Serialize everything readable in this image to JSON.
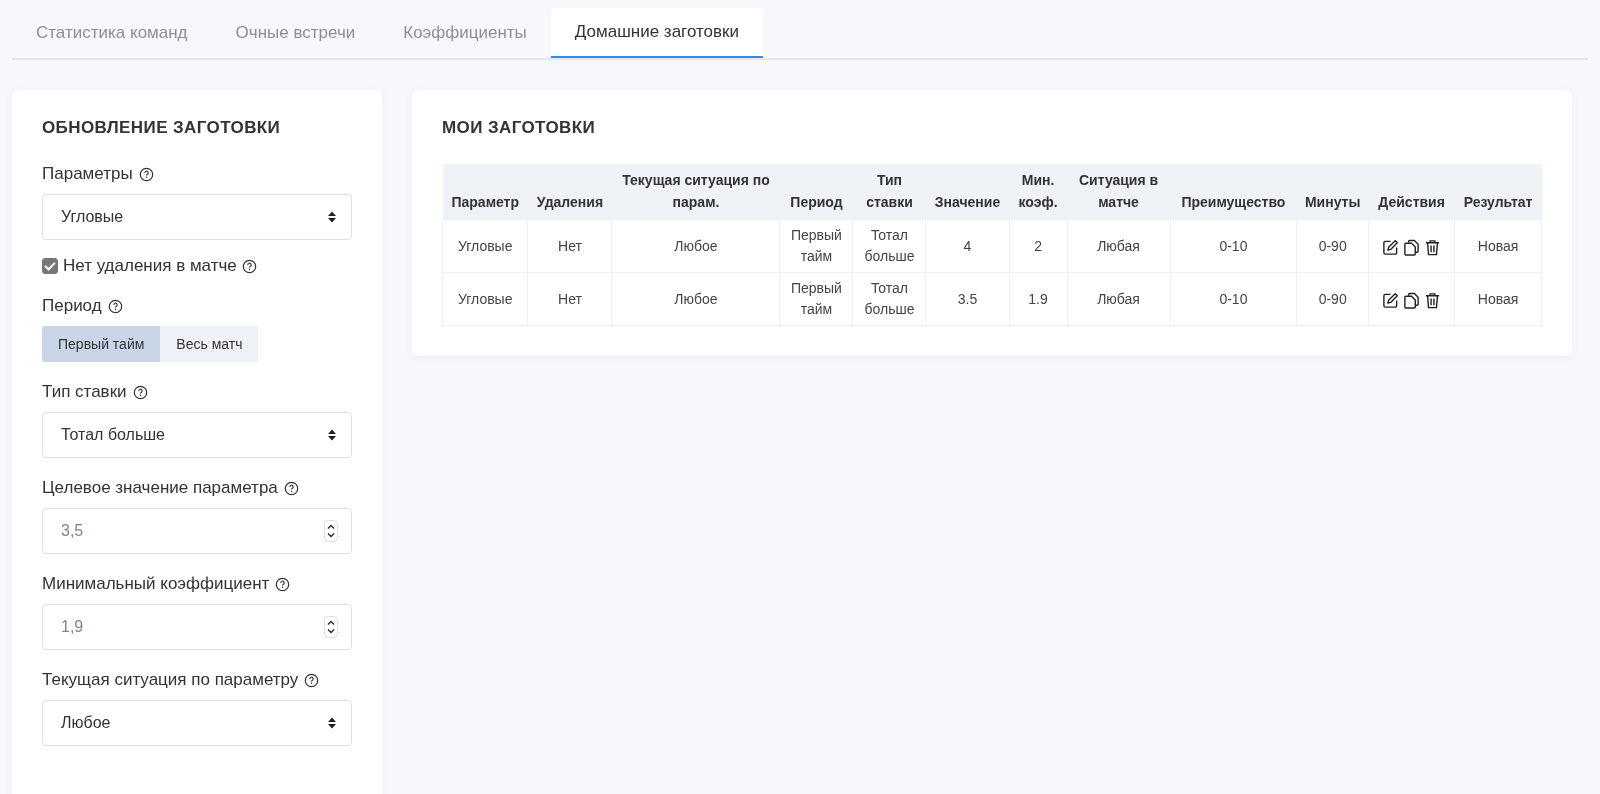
{
  "tabs": [
    {
      "label": "Статистика команд",
      "selected": false
    },
    {
      "label": "Очные встречи",
      "selected": false
    },
    {
      "label": "Коэффициенты",
      "selected": false
    },
    {
      "label": "Домашние заготовки",
      "selected": true
    }
  ],
  "form": {
    "title": "ОБНОВЛЕНИЕ ЗАГОТОВКИ",
    "fields": [
      {
        "kind": "select",
        "label": "Параметры",
        "value": "Угловые"
      },
      {
        "kind": "checkbox",
        "label": "Нет удаления в матче",
        "checked": true
      },
      {
        "kind": "segmented",
        "label": "Период",
        "options": [
          {
            "label": "Первый тайм",
            "selected": true
          },
          {
            "label": "Весь матч",
            "selected": false
          }
        ]
      },
      {
        "kind": "select",
        "label": "Тип ставки",
        "value": "Тотал больше"
      },
      {
        "kind": "number",
        "label": "Целевое значение параметра",
        "placeholder": "3,5"
      },
      {
        "kind": "number",
        "label": "Минимальный коэффициент",
        "placeholder": "1,9"
      },
      {
        "kind": "select",
        "label": "Текущая ситуация по параметру",
        "value": "Любое"
      }
    ]
  },
  "table": {
    "title": "МОИ ЗАГОТОВКИ",
    "columns": [
      "Параметр",
      "Удаления",
      "Текущая ситуация по парам.",
      "Период",
      "Тип ставки",
      "Значение",
      "Мин. коэф.",
      "Ситуация в матче",
      "Преимущество",
      "Минуты",
      "Действия",
      "Результат"
    ],
    "rows": [
      {
        "cells": [
          "Угловые",
          "Нет",
          "Любое",
          "Первый тайм",
          "Тотал больше",
          "4",
          "2",
          "Любая",
          "0-10",
          "0-90"
        ],
        "result": "Новая"
      },
      {
        "cells": [
          "Угловые",
          "Нет",
          "Любое",
          "Первый тайм",
          "Тотал больше",
          "3.5",
          "1.9",
          "Любая",
          "0-10",
          "0-90"
        ],
        "result": "Новая"
      }
    ]
  }
}
